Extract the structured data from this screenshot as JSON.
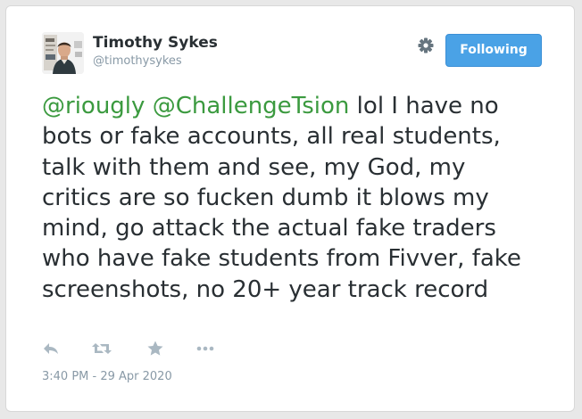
{
  "author": {
    "name": "Timothy Sykes",
    "handle": "@timothysykes",
    "avatar_icon": "profile-photo"
  },
  "header": {
    "settings_icon": "gear-icon",
    "follow_label": "Following"
  },
  "tweet": {
    "mention_1": "@riougly",
    "mention_2": "@ChallengeTsion",
    "body": " lol I have no bots or fake accounts, all real students, talk with them and see, my God, my critics are so fucken dumb it blows my mind, go attack the actual fake traders who have fake students from Fivver, fake screenshots, no 20+ year track record",
    "timestamp": "3:40 PM - 29 Apr 2020"
  },
  "actions": [
    {
      "name": "reply",
      "icon": "reply-icon"
    },
    {
      "name": "retweet",
      "icon": "retweet-icon"
    },
    {
      "name": "favorite",
      "icon": "star-icon"
    },
    {
      "name": "more",
      "icon": "more-icon"
    }
  ],
  "colors": {
    "mention": "#3b9a3f",
    "text": "#292f33",
    "muted": "#8899a6",
    "button": "#4aa2e6",
    "icon": "#aab8c2"
  }
}
